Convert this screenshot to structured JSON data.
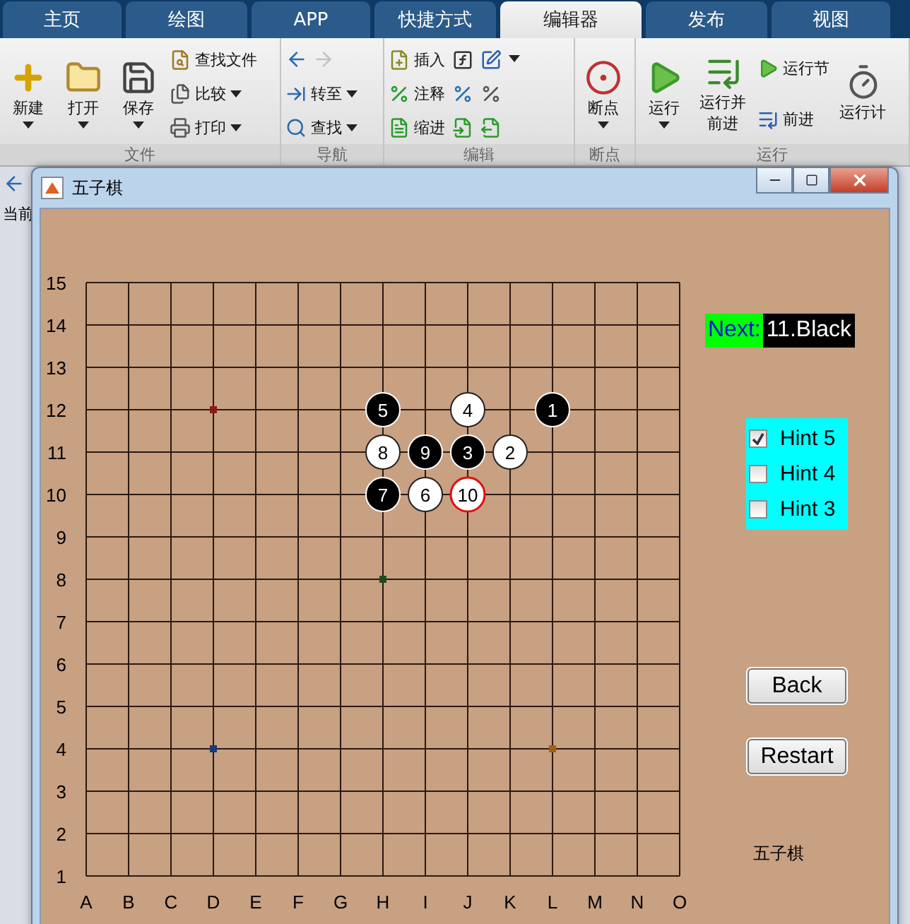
{
  "ribbon": {
    "tabs": [
      {
        "label": "主页",
        "selected": false
      },
      {
        "label": "绘图",
        "selected": false
      },
      {
        "label": "APP",
        "selected": false
      },
      {
        "label": "快捷方式",
        "selected": false
      },
      {
        "label": "编辑器",
        "selected": true
      },
      {
        "label": "发布",
        "selected": false
      },
      {
        "label": "视图",
        "selected": false
      }
    ],
    "groups": [
      {
        "label": "文件",
        "columns": [
          [
            {
              "kind": "large",
              "label": "新建",
              "dropdown": true
            }
          ],
          [
            {
              "kind": "large",
              "label": "打开",
              "dropdown": true
            }
          ],
          [
            {
              "kind": "large",
              "label": "保存",
              "dropdown": true
            }
          ],
          [
            {
              "kind": "small",
              "label": "查找文件",
              "dropdown": false
            },
            {
              "kind": "small",
              "label": "比较",
              "dropdown": true
            },
            {
              "kind": "small",
              "label": "打印",
              "dropdown": true
            }
          ]
        ]
      },
      {
        "label": "导航",
        "columns": [
          [
            {
              "kind": "arrows",
              "forward_disabled": true
            },
            {
              "kind": "small",
              "label": "转至",
              "dropdown": true
            },
            {
              "kind": "small",
              "label": "查找",
              "dropdown": true
            }
          ]
        ]
      },
      {
        "label": "编辑",
        "columns": [
          [
            {
              "kind": "small",
              "label": "插入",
              "dropdown": false
            },
            {
              "kind": "small",
              "label": "注释",
              "dropdown": false
            },
            {
              "kind": "small",
              "label": "缩进",
              "dropdown": false
            }
          ],
          [
            {
              "kind": "icon"
            },
            {
              "kind": "icon"
            },
            {
              "kind": "icon"
            }
          ],
          [
            {
              "kind": "icon"
            },
            {
              "kind": "icon"
            },
            {
              "kind": "icon"
            }
          ],
          [
            {
              "kind": "caret"
            }
          ]
        ]
      },
      {
        "label": "断点",
        "columns": [
          [
            {
              "kind": "large",
              "label": "断点",
              "dropdown": true
            }
          ]
        ]
      },
      {
        "label": "运行",
        "columns": [
          [
            {
              "kind": "large",
              "label": "运行",
              "dropdown": true
            }
          ],
          [
            {
              "kind": "large",
              "label": "运行并前进",
              "dropdown": false
            }
          ],
          [
            {
              "kind": "small",
              "label": "运行节",
              "dropdown": false
            },
            {
              "kind": "small",
              "label": "前进",
              "dropdown": false
            }
          ],
          [
            {
              "kind": "large",
              "label": "运行计",
              "dropdown": false
            }
          ]
        ]
      }
    ]
  },
  "desktop": {
    "folder_label": "当前"
  },
  "figure": {
    "title": "五子棋",
    "board": {
      "columns": [
        "A",
        "B",
        "C",
        "D",
        "E",
        "F",
        "G",
        "H",
        "I",
        "J",
        "K",
        "L",
        "M",
        "N",
        "O"
      ],
      "rows": [
        {
          "label": "15"
        },
        {
          "label": "14"
        },
        {
          "label": "13"
        },
        {
          "label": "12",
          "points": [
            {
              "kind": "empty"
            },
            {
              "kind": "empty"
            },
            {
              "kind": "empty"
            },
            {
              "kind": "star",
              "color": "#8b1a1a"
            },
            {
              "kind": "empty"
            },
            {
              "kind": "empty"
            },
            {
              "kind": "empty"
            },
            {
              "kind": "black",
              "label": "5",
              "last": false
            },
            {
              "kind": "empty"
            },
            {
              "kind": "white",
              "label": "4",
              "last": false
            },
            {
              "kind": "empty"
            },
            {
              "kind": "black",
              "label": "1",
              "last": false
            },
            {
              "kind": "empty"
            },
            {
              "kind": "empty"
            },
            {
              "kind": "empty"
            }
          ]
        },
        {
          "label": "11",
          "points": [
            {
              "kind": "empty"
            },
            {
              "kind": "empty"
            },
            {
              "kind": "empty"
            },
            {
              "kind": "empty"
            },
            {
              "kind": "empty"
            },
            {
              "kind": "empty"
            },
            {
              "kind": "empty"
            },
            {
              "kind": "white",
              "label": "8",
              "last": false
            },
            {
              "kind": "black",
              "label": "9",
              "last": false
            },
            {
              "kind": "black",
              "label": "3",
              "last": false
            },
            {
              "kind": "white",
              "label": "2",
              "last": false
            },
            {
              "kind": "empty"
            },
            {
              "kind": "empty"
            },
            {
              "kind": "empty"
            },
            {
              "kind": "empty"
            }
          ]
        },
        {
          "label": "10",
          "points": [
            {
              "kind": "empty"
            },
            {
              "kind": "empty"
            },
            {
              "kind": "empty"
            },
            {
              "kind": "empty"
            },
            {
              "kind": "empty"
            },
            {
              "kind": "empty"
            },
            {
              "kind": "empty"
            },
            {
              "kind": "black",
              "label": "7",
              "last": false
            },
            {
              "kind": "white",
              "label": "6",
              "last": false
            },
            {
              "kind": "white",
              "label": "10",
              "last": true
            },
            {
              "kind": "empty"
            },
            {
              "kind": "empty"
            },
            {
              "kind": "empty"
            },
            {
              "kind": "empty"
            },
            {
              "kind": "empty"
            }
          ]
        },
        {
          "label": "9"
        },
        {
          "label": "8",
          "points": [
            {
              "kind": "empty"
            },
            {
              "kind": "empty"
            },
            {
              "kind": "empty"
            },
            {
              "kind": "empty"
            },
            {
              "kind": "empty"
            },
            {
              "kind": "empty"
            },
            {
              "kind": "empty"
            },
            {
              "kind": "star",
              "color": "#1f4a1f"
            },
            {
              "kind": "empty"
            },
            {
              "kind": "empty"
            },
            {
              "kind": "empty"
            },
            {
              "kind": "empty"
            },
            {
              "kind": "empty"
            },
            {
              "kind": "empty"
            },
            {
              "kind": "empty"
            }
          ]
        },
        {
          "label": "7"
        },
        {
          "label": "6"
        },
        {
          "label": "5"
        },
        {
          "label": "4",
          "points": [
            {
              "kind": "empty"
            },
            {
              "kind": "empty"
            },
            {
              "kind": "empty"
            },
            {
              "kind": "star",
              "color": "#1a3a7a"
            },
            {
              "kind": "empty"
            },
            {
              "kind": "empty"
            },
            {
              "kind": "empty"
            },
            {
              "kind": "empty"
            },
            {
              "kind": "empty"
            },
            {
              "kind": "empty"
            },
            {
              "kind": "empty"
            },
            {
              "kind": "star",
              "color": "#a06010"
            },
            {
              "kind": "empty"
            },
            {
              "kind": "empty"
            },
            {
              "kind": "empty"
            }
          ]
        },
        {
          "label": "3"
        },
        {
          "label": "2"
        },
        {
          "label": "1"
        }
      ]
    },
    "next": {
      "label": "Next:",
      "value": "11.Black"
    },
    "hints": [
      {
        "label": "Hint 5",
        "checked": true
      },
      {
        "label": "Hint 4",
        "checked": false
      },
      {
        "label": "Hint 3",
        "checked": false
      }
    ],
    "buttons": [
      "Back",
      "Restart"
    ],
    "caption": "五子棋"
  }
}
